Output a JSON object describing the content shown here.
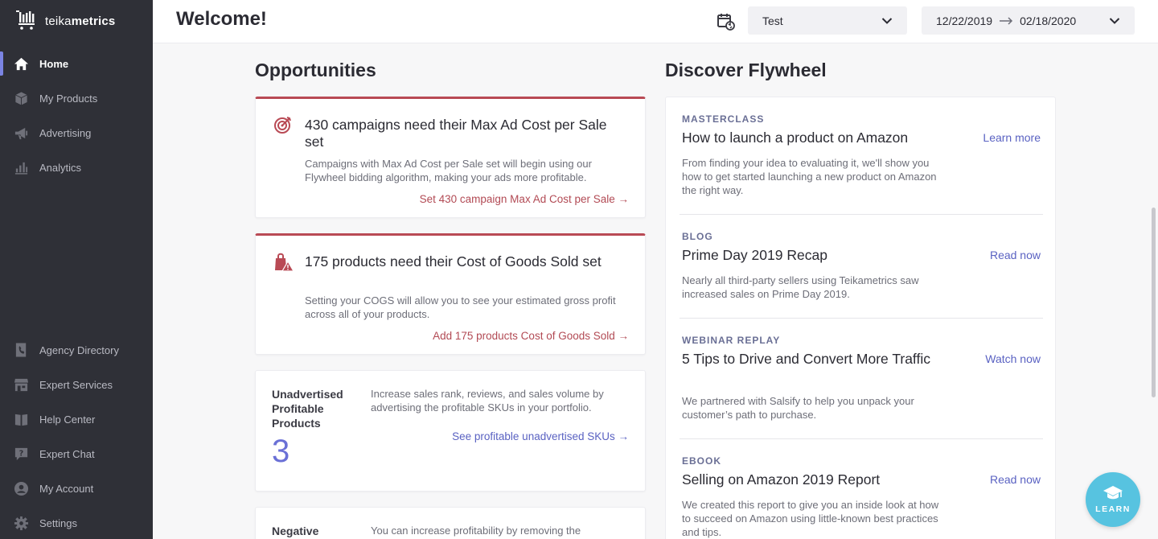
{
  "brand": {
    "name_light": "teika",
    "name_bold": "metrics"
  },
  "sidebar": {
    "items": [
      {
        "label": "Home",
        "icon": "home-icon"
      },
      {
        "label": "My Products",
        "icon": "box-icon"
      },
      {
        "label": "Advertising",
        "icon": "megaphone-icon"
      },
      {
        "label": "Analytics",
        "icon": "bar-chart-icon"
      },
      {
        "label": "Agency Directory",
        "icon": "phone-book-icon"
      },
      {
        "label": "Expert Services",
        "icon": "storefront-icon"
      },
      {
        "label": "Help Center",
        "icon": "book-icon"
      },
      {
        "label": "Expert Chat",
        "icon": "chat-question-icon"
      },
      {
        "label": "My Account",
        "icon": "user-circle-icon"
      },
      {
        "label": "Settings",
        "icon": "gear-icon"
      }
    ],
    "active": "Home"
  },
  "header": {
    "title": "Welcome!",
    "account_select": "Test",
    "date_start": "12/22/2019",
    "date_end": "02/18/2020"
  },
  "opportunities": {
    "title": "Opportunities",
    "cards": [
      {
        "heading": "430 campaigns need their Max Ad Cost per Sale set",
        "desc": "Campaigns with Max Ad Cost per Sale set will begin using our Flywheel bidding algorithm, making your ads more profitable.",
        "link": "Set 430 campaign Max Ad Cost per Sale →"
      },
      {
        "heading": "175 products need their Cost of Goods Sold set",
        "desc": "Setting your COGS will allow you to see your estimated gross profit across all of your products.",
        "link": "Add 175 products Cost of Goods Sold →"
      }
    ],
    "stat_card": {
      "label": "Unadvertised Profitable Products",
      "value": "3",
      "desc": "Increase sales rank, reviews, and sales volume by advertising the profitable SKUs in your portfolio.",
      "link": "See profitable unadvertised SKUs →"
    },
    "partial_card": {
      "label": "Negative",
      "desc": "You can increase profitability by removing the"
    }
  },
  "discover": {
    "title": "Discover Flywheel",
    "items": [
      {
        "category": "MASTERCLASS",
        "title": "How to launch a product on Amazon",
        "action": "Learn more",
        "desc": "From finding your idea to evaluating it, we'll show you how to get started launching a new product on Amazon the right way."
      },
      {
        "category": "BLOG",
        "title": "Prime Day 2019 Recap",
        "action": "Read now",
        "desc": "Nearly all third-party sellers using Teikametrics saw increased sales on Prime Day 2019."
      },
      {
        "category": "WEBINAR REPLAY",
        "title": "5 Tips to Drive and Convert More Traffic",
        "action": "Watch now",
        "desc": "We partnered with Salsify to help you unpack your customer’s path to purchase."
      },
      {
        "category": "EBOOK",
        "title": "Selling on Amazon 2019 Report",
        "action": "Read now",
        "desc": "We created this report to give you an inside look at how to succeed on Amazon using little-known best practices and tips."
      }
    ]
  },
  "learn_button": "LEARN",
  "colors": {
    "sidebar": "#2f3037",
    "accent": "#7b84e3",
    "alert": "#b94a55",
    "link_blue": "#5a62c2",
    "learn": "#57c3e0"
  }
}
